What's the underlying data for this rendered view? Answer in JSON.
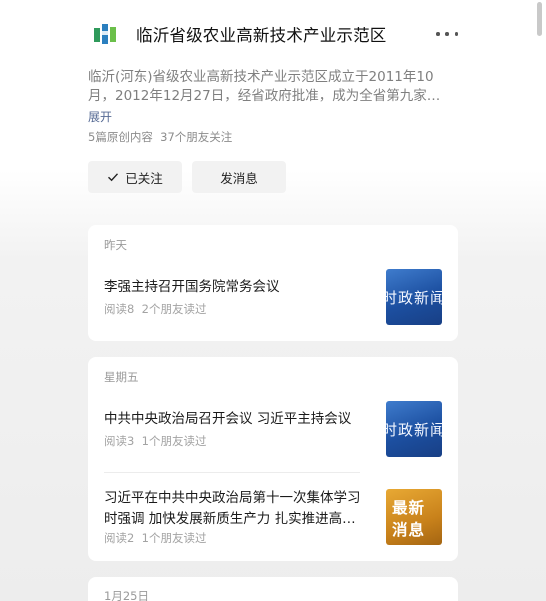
{
  "profile": {
    "name": "临沂省级农业高新技术产业示范区",
    "description": "临沂(河东)省级农业高新技术产业示范区成立于2011年10月，2012年12月27日，经省政府批准，成为全省第九家…",
    "expand_label": "展开",
    "stats": "5篇原创内容  37个朋友关注",
    "follow_label": "已关注",
    "message_label": "发消息",
    "logo_colors": [
      "#2f9a5b",
      "#2b7fbf",
      "#6bbf4a"
    ]
  },
  "feed": [
    {
      "date": "昨天",
      "articles": [
        {
          "title": "李强主持召开国务院常务会议",
          "meta": "阅读8  2个朋友读过",
          "thumb_text": "时政新闻",
          "thumb_style": "blue"
        }
      ]
    },
    {
      "date": "星期五",
      "articles": [
        {
          "title": "中共中央政治局召开会议 习近平主持会议",
          "meta": "阅读3  1个朋友读过",
          "thumb_text": "时政新闻",
          "thumb_style": "blue"
        },
        {
          "title": "习近平在中共中央政治局第十一次集体学习时强调 加快发展新质生产力 扎实推进高…",
          "meta": "阅读2  1个朋友读过",
          "thumb_line1": "最新",
          "thumb_line2": "消息",
          "thumb_style": "orange"
        }
      ]
    },
    {
      "date": "1月25日",
      "articles": []
    }
  ]
}
